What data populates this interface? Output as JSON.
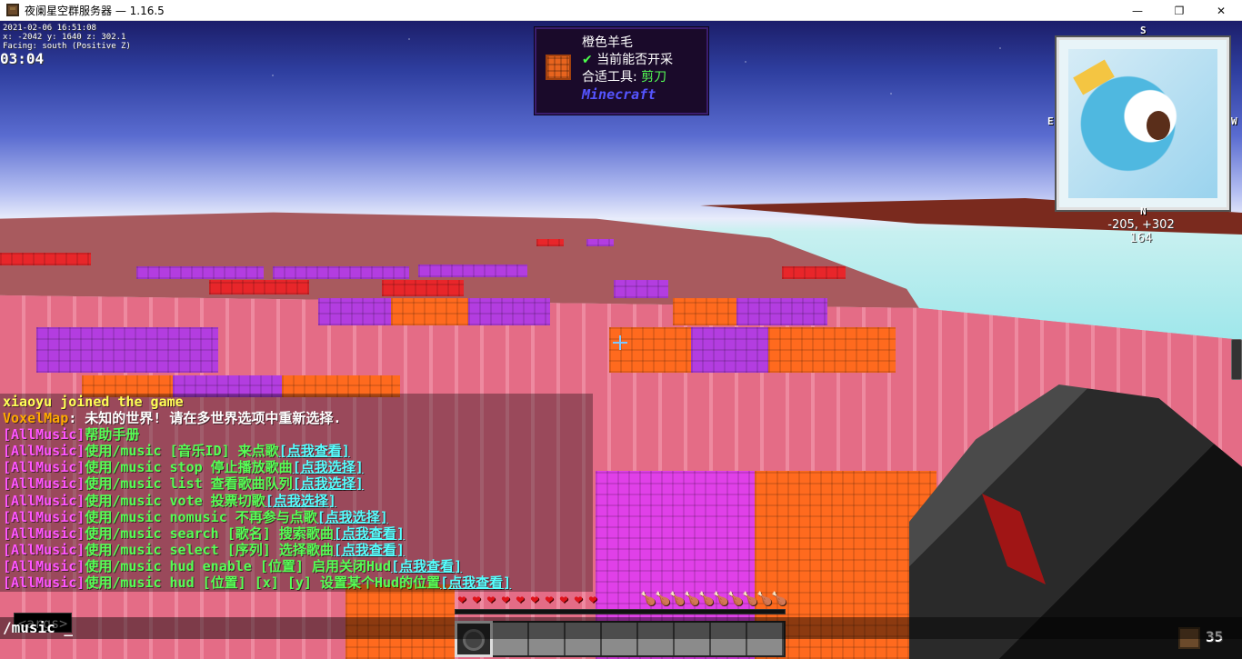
{
  "window": {
    "title": "夜阑星空群服务器 — 1.16.5",
    "controls": {
      "minimize": "—",
      "maximize": "❐",
      "close": "✕"
    }
  },
  "debug": {
    "line1": "2021-02-06 16:51:08",
    "line2": "x: -2042 y: 1640 z: 302.1",
    "line3": "Facing: south (Positive Z)"
  },
  "clock": "03:04",
  "waila": {
    "block_name": "橙色羊毛",
    "check": "✔",
    "harvest": "当前能否开采",
    "tool_label": "合适工具: ",
    "tool_value": "剪刀",
    "mod": "Minecraft"
  },
  "minimap": {
    "north": "N",
    "south": "S",
    "east": "E",
    "west": "W",
    "coords": "-205, +302",
    "height": "164"
  },
  "chat": {
    "l1": "xiaoyu joined the game",
    "l2_name": "VoxelMap",
    "l2_text": ": 未知的世界! 请在多世界选项中重新选择.",
    "prefix": "[AllMusic]",
    "l3": "帮助手册",
    "l4_cmd": "使用/music [音乐ID] 来点歌",
    "l4_link": "[点我查看]",
    "l5_cmd": "使用/music stop 停止播放歌曲",
    "l5_link": "[点我选择]",
    "l6_cmd": "使用/music list 查看歌曲队列",
    "l6_link": "[点我选择]",
    "l7_cmd": "使用/music vote 投票切歌",
    "l7_link": "[点我选择]",
    "l8_cmd": "使用/music nomusic 不再参与点歌",
    "l8_link": "[点我选择]",
    "l9_cmd": "使用/music search [歌名] 搜索歌曲",
    "l9_link": "[点我查看]",
    "l10_cmd": "使用/music select [序列] 选择歌曲",
    "l10_link": "[点我查看]",
    "l11_cmd": "使用/music hud enable [位置] 启用关闭Hud",
    "l11_link": "[点我查看]",
    "l12_cmd": "使用/music hud [位置] [x] [y] 设置某个Hud的位置",
    "l12_link": "[点我查看]"
  },
  "suggestion": "<args>",
  "input": "/music _",
  "hud": {
    "heart": "❤",
    "food": "🍗",
    "hearts": 10,
    "food_count": 10,
    "offhand_count": "35"
  }
}
